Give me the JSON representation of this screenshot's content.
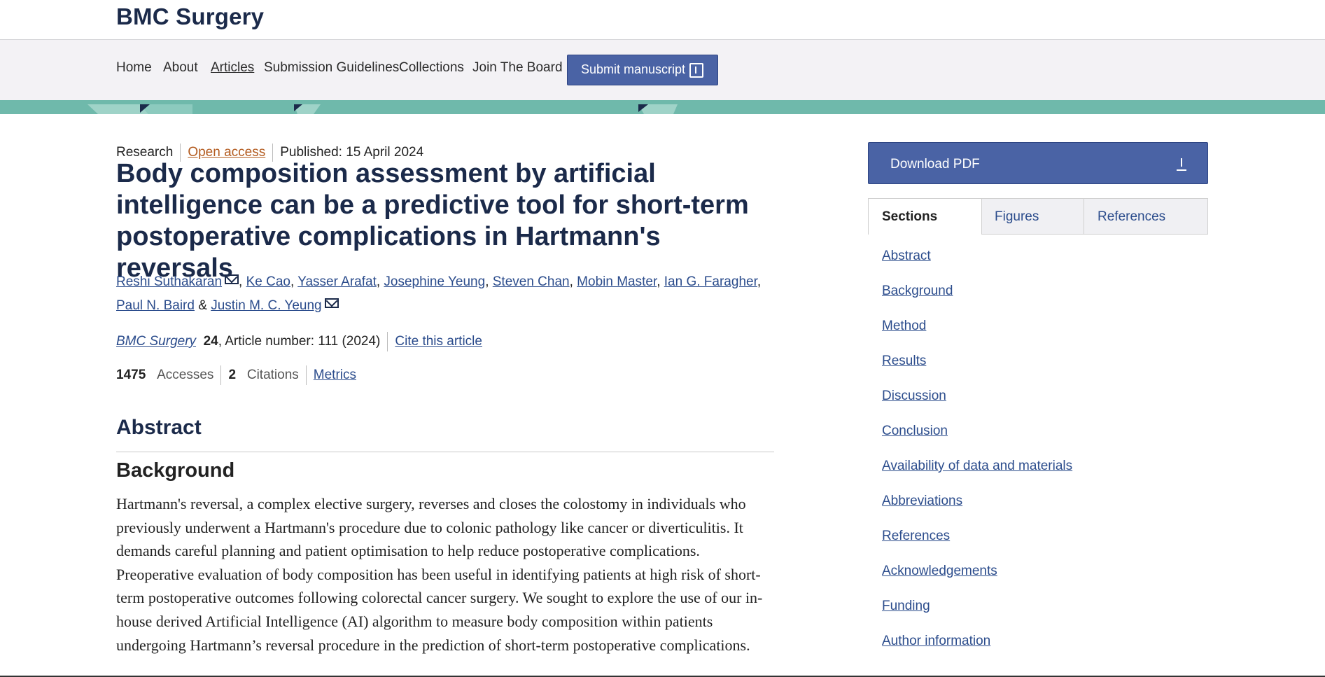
{
  "header": {
    "brand": "BMC Surgery"
  },
  "nav": {
    "items": [
      "Home",
      "About",
      "Articles",
      "Submission Guidelines",
      "Collections",
      "Join The Board"
    ],
    "active": "Articles",
    "submit_label": "Submit manuscript"
  },
  "colors": {
    "accent": "#4a63a5",
    "band": "#6fb9ab",
    "title": "#1b2a4a",
    "link": "#2b4c8c",
    "open_access": "#b35b1f"
  },
  "article": {
    "type": "Research",
    "access": "Open access",
    "published": "Published: 15 April 2024",
    "title": "Body composition assessment by artificial intelligence can be a predictive tool for short-term postoperative complications in Hartmann's reversals",
    "authors": [
      "Reshi Suthakaran",
      "Ke Cao",
      "Yasser Arafat",
      "Josephine Yeung",
      "Steven Chan",
      "Mobin Master",
      "Ian G. Faragher",
      "Paul N. Baird",
      "Justin M. C. Yeung"
    ],
    "journal": "BMC Surgery",
    "volume": "24",
    "article_number": ", Article number: 111 (2024)",
    "cite_label": "Cite this article",
    "accesses_count": "1475",
    "accesses_label": "Accesses",
    "citations_count": "2",
    "citations_label": "Citations",
    "metrics_label": "Metrics"
  },
  "abstract": {
    "heading": "Abstract",
    "background_heading": "Background",
    "background_text": "Hartmann's reversal, a complex elective surgery, reverses and closes the colostomy in individuals who previously underwent a Hartmann's procedure due to colonic pathology like cancer or diverticulitis. It demands careful planning and patient optimisation to help reduce postoperative complications. Preoperative evaluation of body composition has been useful in identifying patients at high risk of short-term postoperative outcomes following colorectal cancer surgery. We sought to explore the use of our in-house derived Artificial Intelligence (AI) algorithm to measure body composition within patients undergoing Hartmann’s reversal procedure in the prediction of short-term postoperative complications."
  },
  "sidebar": {
    "download_label": "Download PDF",
    "tabs": [
      "Sections",
      "Figures",
      "References"
    ],
    "sections": [
      "Abstract",
      "Background",
      "Method",
      "Results",
      "Discussion",
      "Conclusion",
      "Availability of data and materials",
      "Abbreviations",
      "References",
      "Acknowledgements",
      "Funding",
      "Author information"
    ]
  }
}
